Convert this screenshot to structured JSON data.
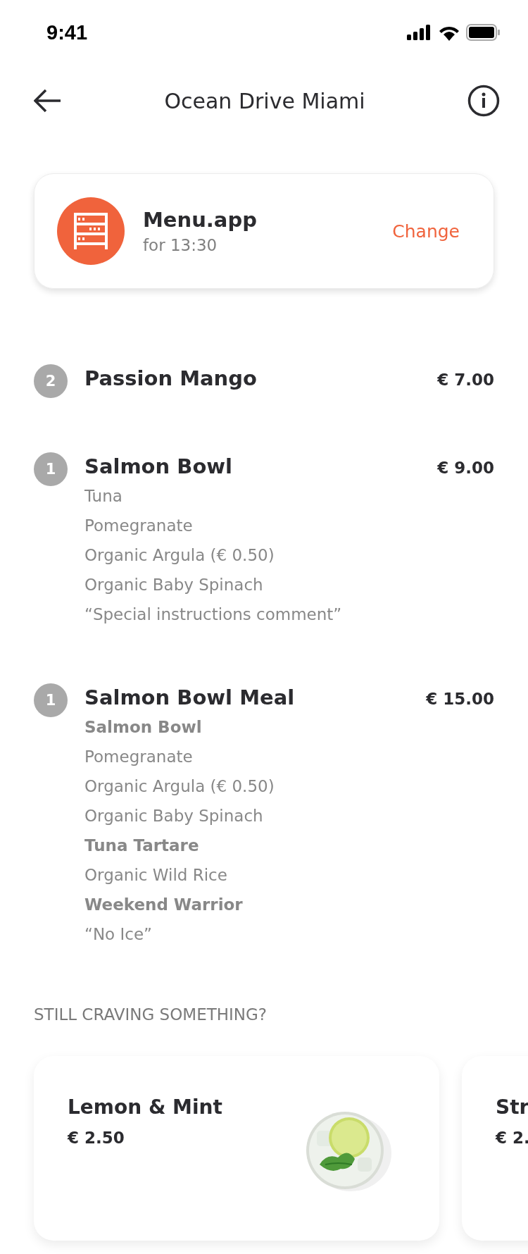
{
  "status_bar": {
    "time": "9:41"
  },
  "header": {
    "title": "Ocean Drive Miami"
  },
  "venue": {
    "name": "Menu.app",
    "time": "for 13:30",
    "action": "Change"
  },
  "items": [
    {
      "quantity": "2",
      "name": "Passion Mango",
      "price": "€ 7.00"
    },
    {
      "quantity": "1",
      "name": "Salmon Bowl",
      "price": "€ 9.00",
      "lines": [
        {
          "text": "Tuna",
          "bold": false
        },
        {
          "text": "Pomegranate",
          "bold": false
        },
        {
          "text": "Organic Argula  (€ 0.50)",
          "bold": false
        },
        {
          "text": "Organic Baby Spinach",
          "bold": false
        },
        {
          "text": "“Special instructions comment”",
          "bold": false
        }
      ]
    },
    {
      "quantity": "1",
      "name": "Salmon Bowl Meal",
      "price": "€ 15.00",
      "lines": [
        {
          "text": "Salmon Bowl",
          "bold": true
        },
        {
          "text": "Pomegranate",
          "bold": false
        },
        {
          "text": "Organic Argula  (€ 0.50)",
          "bold": false
        },
        {
          "text": "Organic Baby Spinach",
          "bold": false
        },
        {
          "text": "Tuna Tartare",
          "bold": true
        },
        {
          "text": "Organic Wild Rice",
          "bold": false
        },
        {
          "text": "Weekend Warrior",
          "bold": true
        },
        {
          "text": "“No Ice”",
          "bold": false
        }
      ]
    }
  ],
  "suggestions": {
    "title": "STILL CRAVING SOMETHING?",
    "cards": [
      {
        "name": "Lemon & Mint",
        "price": "€ 2.50",
        "kind": "picture"
      },
      {
        "name": "Str",
        "price": "€ 2.",
        "kind": "cut"
      }
    ]
  }
}
